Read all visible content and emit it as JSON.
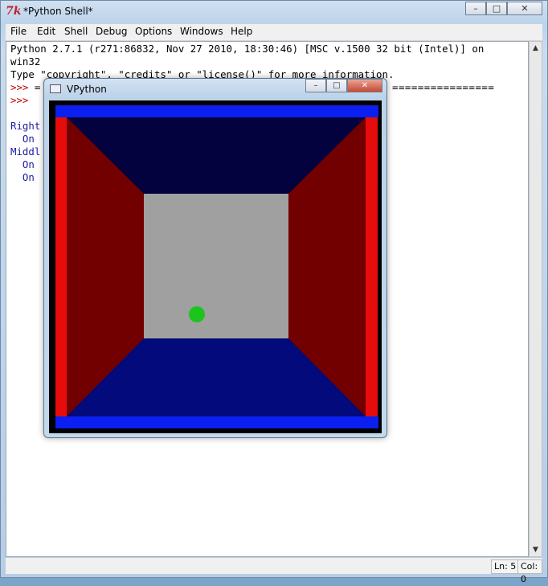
{
  "shell": {
    "title": "*Python Shell*",
    "icon_glyph": "7k",
    "caption": {
      "min": "–",
      "max": "□",
      "close": "✕"
    },
    "menu": [
      "File",
      "Edit",
      "Shell",
      "Debug",
      "Options",
      "Windows",
      "Help"
    ],
    "lines": {
      "l1": "Python 2.7.1 (r271:86832, Nov 27 2010, 18:30:46) [MSC v.1500 32 bit (Intel)] on",
      "l2": "win32",
      "l3": "Type \"copyright\", \"credits\" or \"license()\" for more information.",
      "l4_prompt": ">>> ",
      "l4_rest": "= ",
      "l4_rule": "================",
      "l5_prompt": ">>> ",
      "l6": "Right",
      "l7": "  On",
      "l8": "Middl",
      "l9": "  On",
      "l10": "  On"
    },
    "status": {
      "ln": "Ln: 5",
      "col": "Col: 0"
    }
  },
  "vpython": {
    "title": "VPython",
    "caption": {
      "min": "–",
      "max": "□",
      "close": "✕"
    },
    "colors": {
      "frame_blue": "#0a1ff0",
      "top_panel": "#03023e",
      "bottom_panel": "#020a7c",
      "side_panel": "#730000",
      "side_edge": "#e60c0c",
      "back_wall": "#a0a0a0",
      "ball": "#1cc41c"
    }
  }
}
